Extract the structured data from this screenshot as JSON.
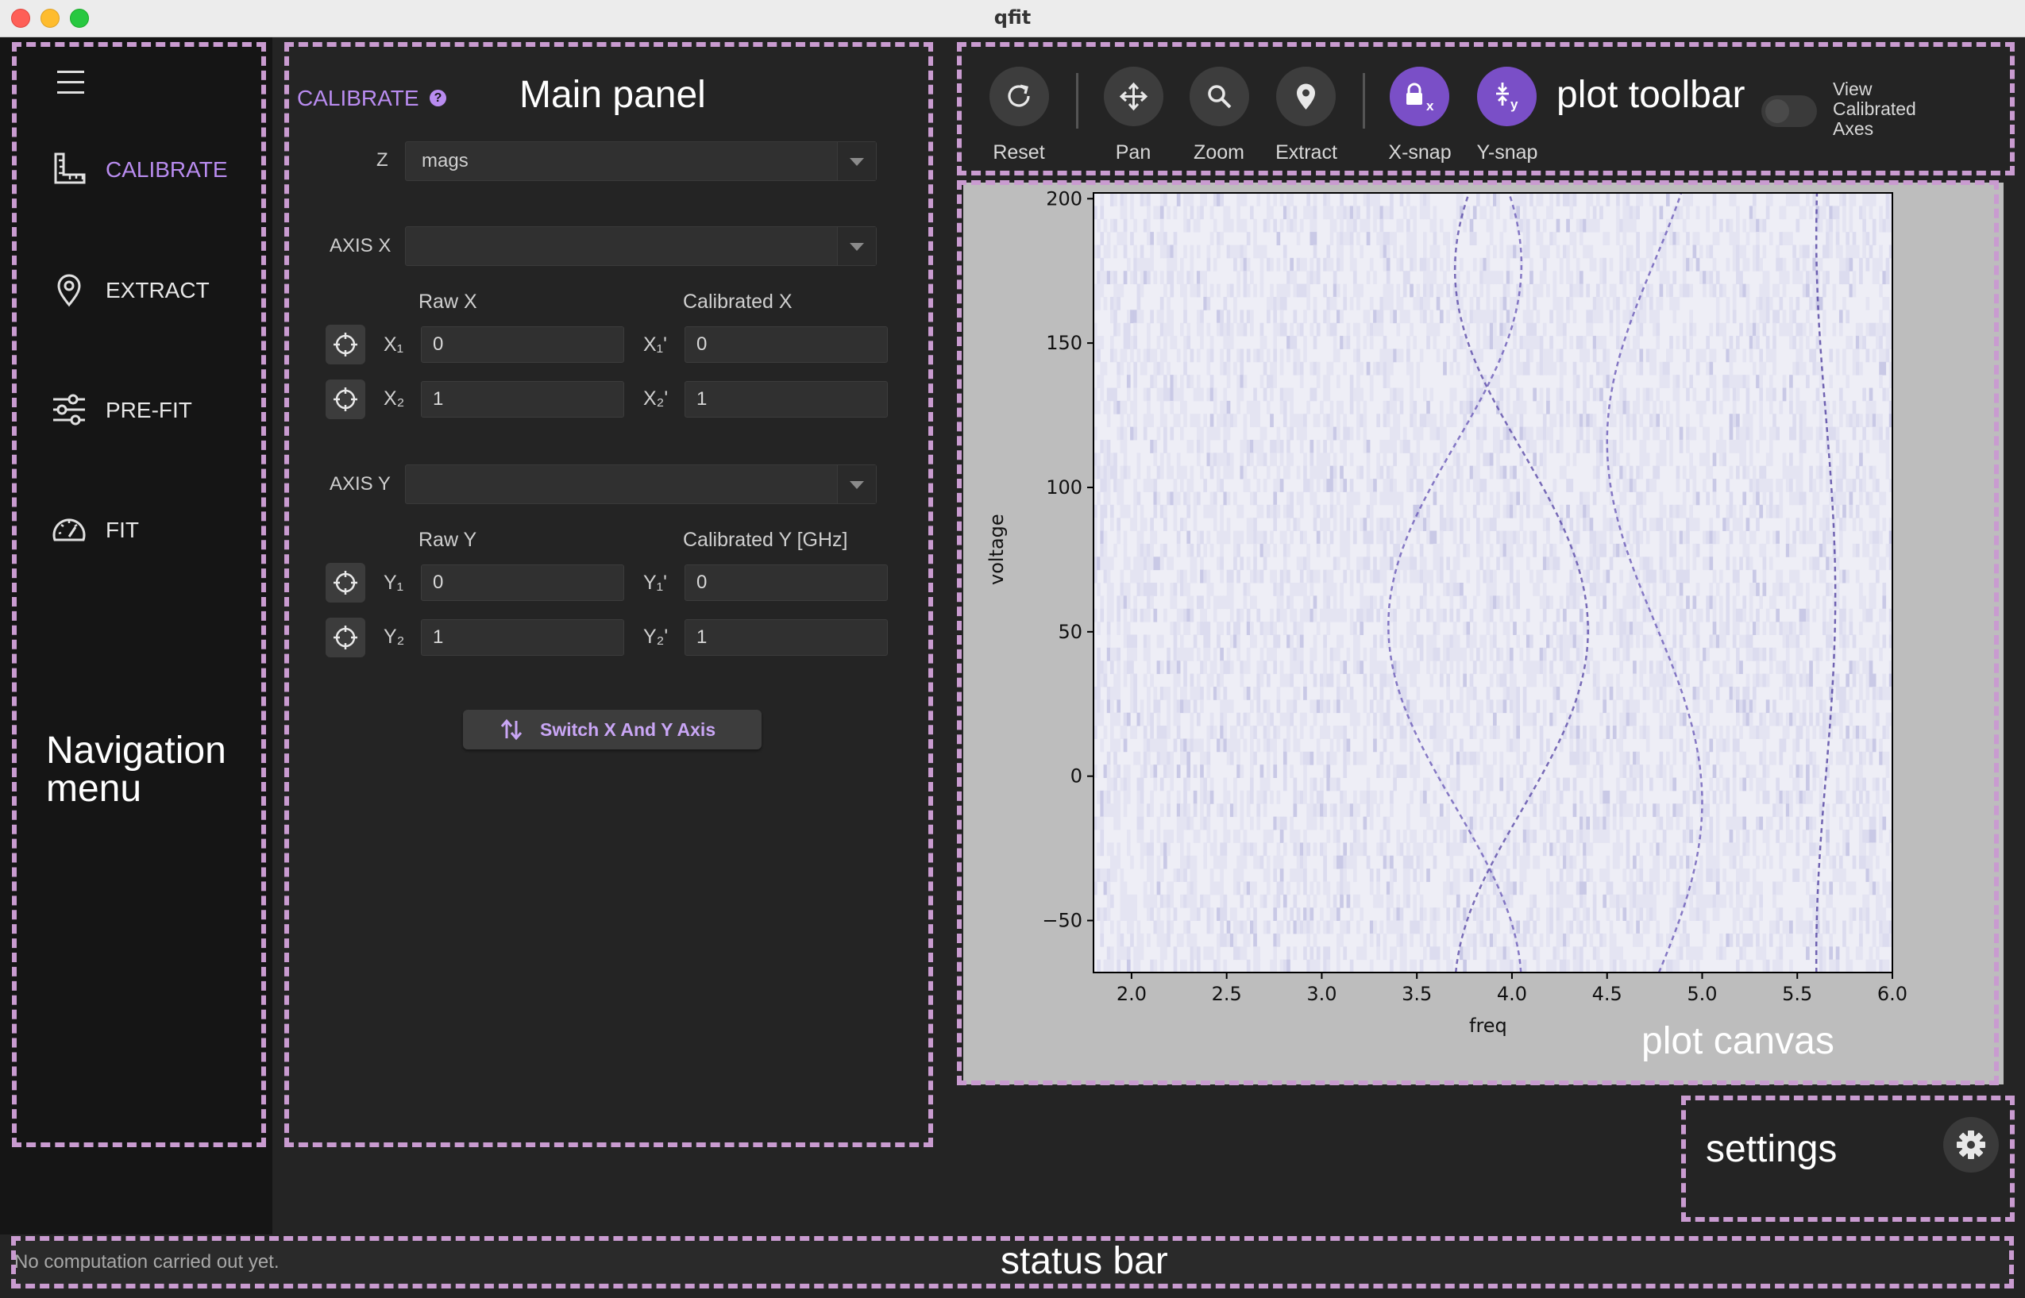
{
  "window": {
    "title": "qfit"
  },
  "annotations": {
    "navigation": "Navigation\nmenu",
    "main_panel": "Main panel",
    "plot_toolbar": "plot toolbar",
    "plot_canvas": "plot canvas",
    "settings": "settings",
    "status_bar": "status bar"
  },
  "nav": {
    "items": [
      {
        "label": "CALIBRATE",
        "icon": "ruler-icon",
        "active": true
      },
      {
        "label": "EXTRACT",
        "icon": "map-pin-icon",
        "active": false
      },
      {
        "label": "PRE-FIT",
        "icon": "sliders-icon",
        "active": false
      },
      {
        "label": "FIT",
        "icon": "gauge-icon",
        "active": false
      }
    ]
  },
  "calibrate": {
    "title": "CALIBRATE",
    "help": "?",
    "z_label": "Z",
    "z_value": "mags",
    "axis_x_label": "AXIS X",
    "axis_x_value": "",
    "raw_x_header": "Raw X",
    "cal_x_header": "Calibrated X",
    "x1_label": "X₁",
    "x1_raw": "0",
    "x1_cal_label": "X₁'",
    "x1_cal": "0",
    "x2_label": "X₂",
    "x2_raw": "1",
    "x2_cal_label": "X₂'",
    "x2_cal": "1",
    "axis_y_label": "AXIS Y",
    "axis_y_value": "",
    "raw_y_header": "Raw Y",
    "cal_y_header": "Calibrated Y [GHz]",
    "y1_label": "Y₁",
    "y1_raw": "0",
    "y1_cal_label": "Y₁'",
    "y1_cal": "0",
    "y2_label": "Y₂",
    "y2_raw": "1",
    "y2_cal_label": "Y₂'",
    "y2_cal": "1",
    "switch_label": "Switch X And Y Axis"
  },
  "toolbar": {
    "reset": "Reset",
    "pan": "Pan",
    "zoom": "Zoom",
    "extract": "Extract",
    "xsnap": "X-snap",
    "ysnap": "Y-snap",
    "x_sub": "x",
    "y_sub": "y",
    "view_calibrated": "View\nCalibrated\nAxes",
    "view_calibrated_on": false,
    "accent": "#7a4fc7"
  },
  "chart_data": {
    "type": "heatmap",
    "xlabel": "freq",
    "ylabel": "voltage",
    "xlim": [
      1.8,
      6.0
    ],
    "ylim": [
      -68,
      202
    ],
    "xticks": [
      "2.0",
      "2.5",
      "3.0",
      "3.5",
      "4.0",
      "4.5",
      "5.0",
      "5.5",
      "6.0"
    ],
    "yticks": [
      "200",
      "150",
      "100",
      "50",
      "0",
      "−50"
    ],
    "colormap": "Purples"
  },
  "status": {
    "text": "No computation carried out yet."
  }
}
